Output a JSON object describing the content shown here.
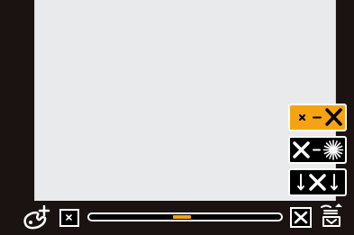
{
  "side_buttons": [
    {
      "id": "small-to-large",
      "icon": "small-x-to-large-x-icon",
      "selected": true
    },
    {
      "id": "large-to-star",
      "icon": "large-x-to-starburst-icon",
      "selected": false
    },
    {
      "id": "zoom-in",
      "icon": "arrows-into-x-icon",
      "selected": false
    }
  ],
  "zoom_slider": {
    "value": 0.48
  },
  "colors": {
    "accent": "#f5a314",
    "background": "#1a1311",
    "viewport": "#e8eaec",
    "outline": "#ffffff"
  }
}
